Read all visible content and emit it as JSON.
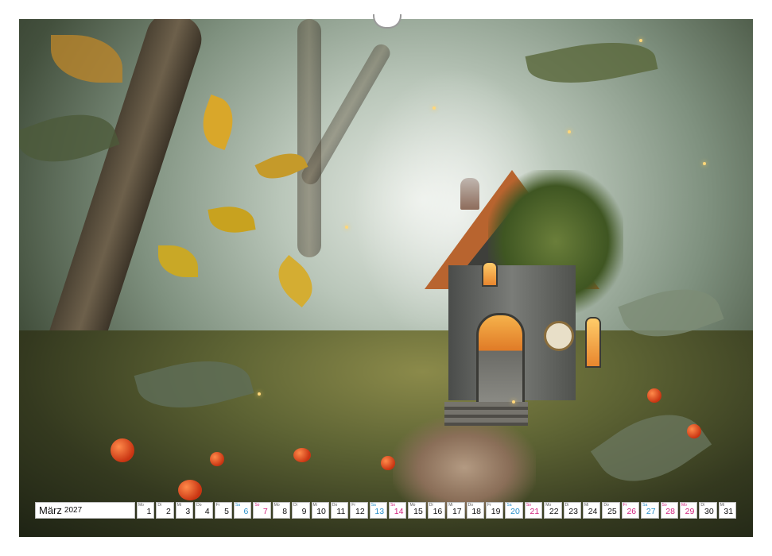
{
  "calendar": {
    "month": "März",
    "year": "2027",
    "days": [
      {
        "wd": "Mo",
        "n": "1",
        "type": "weekday"
      },
      {
        "wd": "Di",
        "n": "2",
        "type": "weekday"
      },
      {
        "wd": "Mi",
        "n": "3",
        "type": "weekday"
      },
      {
        "wd": "Do",
        "n": "4",
        "type": "weekday"
      },
      {
        "wd": "Fr",
        "n": "5",
        "type": "weekday"
      },
      {
        "wd": "Sa",
        "n": "6",
        "type": "sat"
      },
      {
        "wd": "So",
        "n": "7",
        "type": "sun"
      },
      {
        "wd": "Mo",
        "n": "8",
        "type": "weekday"
      },
      {
        "wd": "Di",
        "n": "9",
        "type": "weekday"
      },
      {
        "wd": "Mi",
        "n": "10",
        "type": "weekday"
      },
      {
        "wd": "Do",
        "n": "11",
        "type": "weekday"
      },
      {
        "wd": "Fr",
        "n": "12",
        "type": "weekday"
      },
      {
        "wd": "Sa",
        "n": "13",
        "type": "sat"
      },
      {
        "wd": "So",
        "n": "14",
        "type": "sun"
      },
      {
        "wd": "Mo",
        "n": "15",
        "type": "weekday"
      },
      {
        "wd": "Di",
        "n": "16",
        "type": "weekday"
      },
      {
        "wd": "Mi",
        "n": "17",
        "type": "weekday"
      },
      {
        "wd": "Do",
        "n": "18",
        "type": "weekday"
      },
      {
        "wd": "Fr",
        "n": "19",
        "type": "weekday"
      },
      {
        "wd": "Sa",
        "n": "20",
        "type": "sat"
      },
      {
        "wd": "So",
        "n": "21",
        "type": "sun"
      },
      {
        "wd": "Mo",
        "n": "22",
        "type": "weekday"
      },
      {
        "wd": "Di",
        "n": "23",
        "type": "weekday"
      },
      {
        "wd": "Mi",
        "n": "24",
        "type": "weekday"
      },
      {
        "wd": "Do",
        "n": "25",
        "type": "weekday"
      },
      {
        "wd": "Fr",
        "n": "26",
        "type": "hol"
      },
      {
        "wd": "Sa",
        "n": "27",
        "type": "sat"
      },
      {
        "wd": "So",
        "n": "28",
        "type": "sun"
      },
      {
        "wd": "Mo",
        "n": "29",
        "type": "hol"
      },
      {
        "wd": "Di",
        "n": "30",
        "type": "weekday"
      },
      {
        "wd": "Mi",
        "n": "31",
        "type": "weekday"
      }
    ]
  },
  "colors": {
    "saturday": "#2a8fc9",
    "sunday_holiday": "#d1237d"
  }
}
